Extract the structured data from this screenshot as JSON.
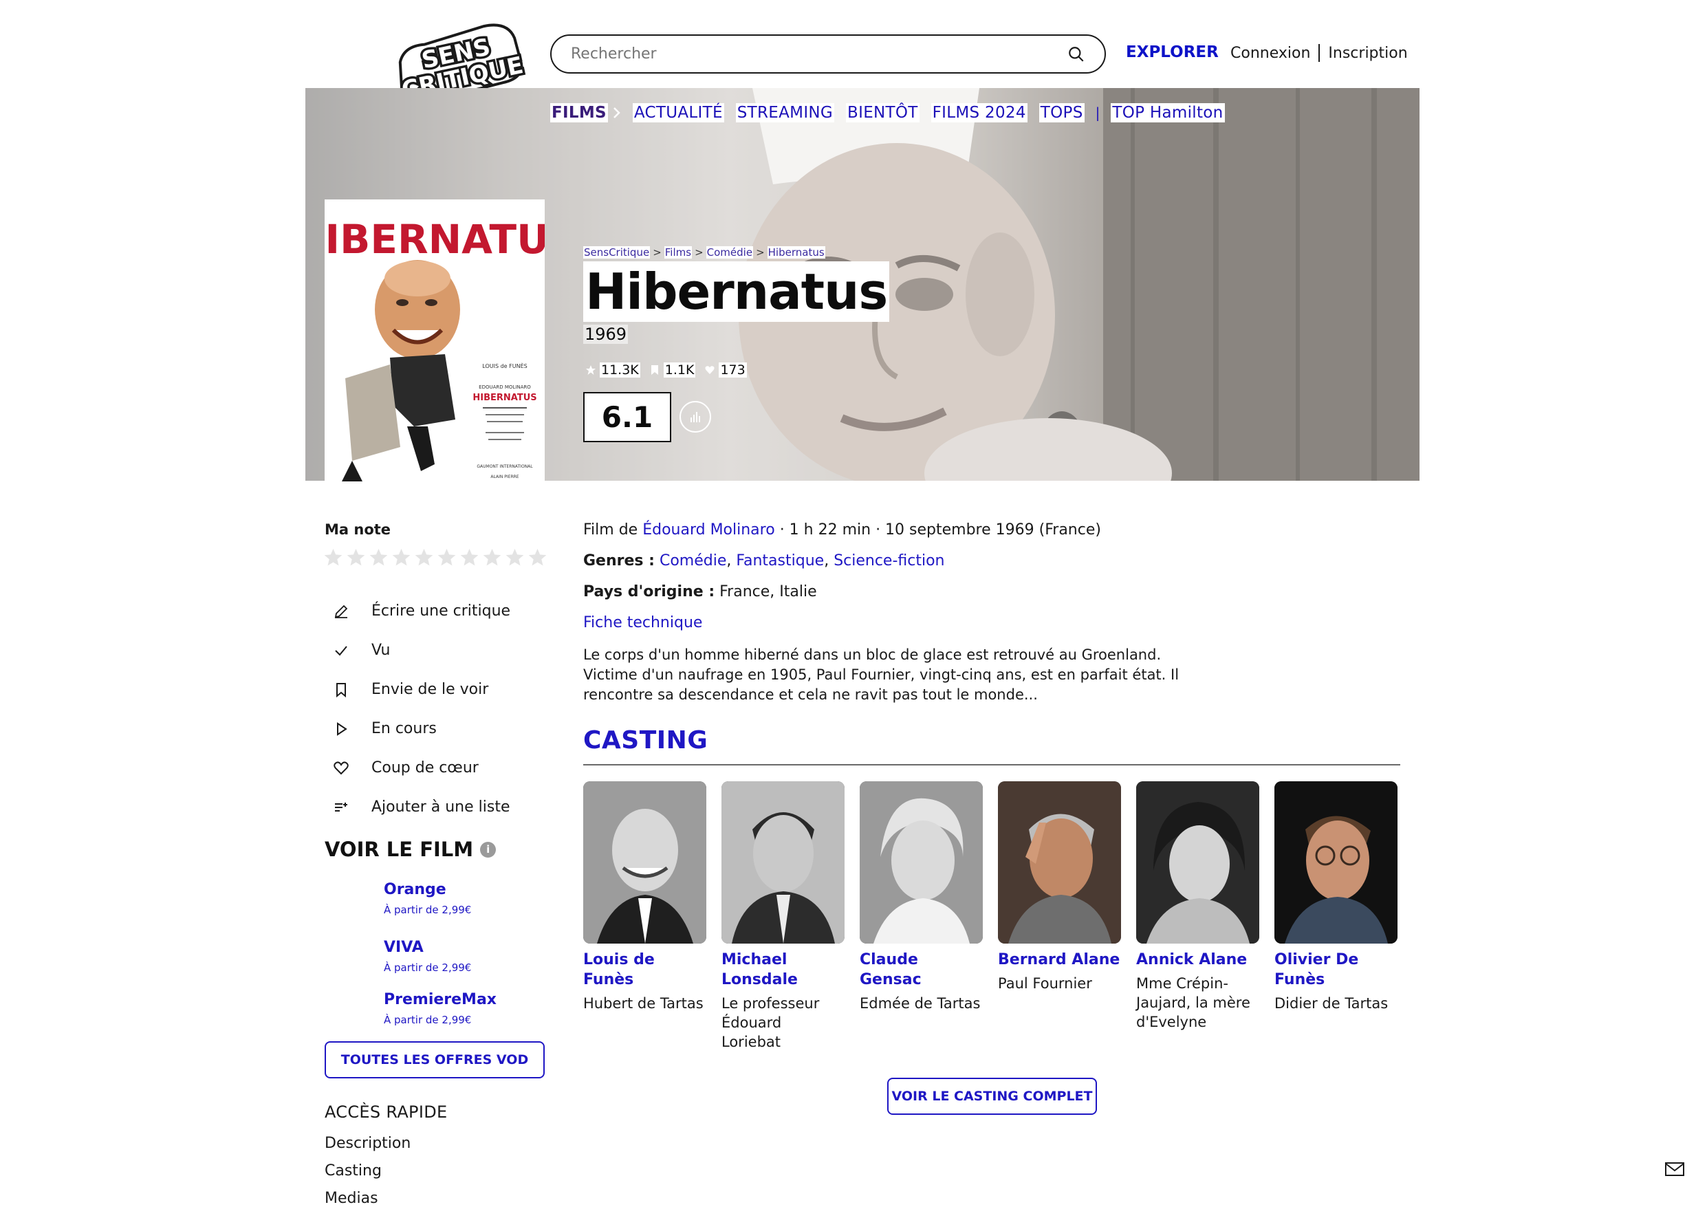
{
  "header": {
    "logo_text_line1": "SENS",
    "logo_text_line2": "CRITIQUE",
    "search_placeholder": "Rechercher",
    "explorer": "EXPLORER",
    "login": "Connexion",
    "signup": "Inscription"
  },
  "nav": {
    "films": "FILMS",
    "items": [
      "ACTUALITÉ",
      "STREAMING",
      "BIENTÔT",
      "FILMS 2024",
      "TOPS"
    ],
    "top_hamilton": "TOP Hamilton"
  },
  "breadcrumb": [
    "SensCritique",
    "Films",
    "Comédie",
    "Hibernatus"
  ],
  "movie": {
    "title": "Hibernatus",
    "year": "1969",
    "stats": {
      "ratings": "11.3K",
      "wishlist": "1.1K",
      "favorites": "173"
    },
    "score": "6.1",
    "poster": {
      "title": "HIBERNATUS",
      "actor": "LOUIS de FUNÈS",
      "director_line": "EDOUARD MOLINARO",
      "film_title_small": "HIBERNATUS",
      "studio": "GAUMONT INTERNATIONAL",
      "music": "ALAIN PIERRE"
    }
  },
  "left": {
    "ma_note": "Ma note",
    "star_count": 10,
    "actions": [
      {
        "label": "Écrire une critique",
        "icon": "pencil-icon"
      },
      {
        "label": "Vu",
        "icon": "check-icon"
      },
      {
        "label": "Envie de le voir",
        "icon": "bookmark-icon"
      },
      {
        "label": "En cours",
        "icon": "play-icon"
      },
      {
        "label": "Coup de cœur",
        "icon": "heart-icon"
      },
      {
        "label": "Ajouter à une liste",
        "icon": "list-add-icon"
      }
    ],
    "voir_title": "VOIR LE FILM",
    "offers": [
      {
        "name": "Orange",
        "price": "À partir de 2,99€"
      },
      {
        "name": "VIVA",
        "price": "À partir de 2,99€"
      },
      {
        "name": "PremiereMax",
        "price": "À partir de 2,99€"
      }
    ],
    "vod_button": "TOUTES LES OFFRES VOD",
    "acces_title": "ACCÈS RAPIDE",
    "quick_links": [
      "Description",
      "Casting",
      "Medias"
    ]
  },
  "details": {
    "film_de": "Film de",
    "director": "Édouard Molinaro",
    "meta": "· 1 h 22 min · 10 septembre 1969 (France)",
    "genres_label": "Genres :",
    "genres": [
      "Comédie",
      "Fantastique",
      "Science-fiction"
    ],
    "pays_label": "Pays d'origine :",
    "pays": "France, Italie",
    "fiche": "Fiche technique",
    "synopsis": "Le corps d'un homme hiberné dans un bloc de glace est retrouvé au Groenland. Victime d'un naufrage en 1905, Paul Fournier, vingt-cinq ans, est en parfait état. Il rencontre sa descendance et cela ne ravit pas tout le monde..."
  },
  "casting": {
    "title": "CASTING",
    "actors": [
      {
        "name": "Louis de Funès",
        "role": "Hubert de Tartas"
      },
      {
        "name": "Michael Lonsdale",
        "role": "Le professeur Édouard Loriebat"
      },
      {
        "name": "Claude Gensac",
        "role": "Edmée de Tartas"
      },
      {
        "name": "Bernard Alane",
        "role": "Paul Fournier"
      },
      {
        "name": "Annick Alane",
        "role": "Mme Crépin-Jaujard, la mère d'Evelyne"
      },
      {
        "name": "Olivier De Funès",
        "role": "Didier de Tartas"
      }
    ],
    "button": "VOIR LE CASTING COMPLET"
  },
  "colors": {
    "accent": "#1f17c4",
    "nav": "#1c11b8",
    "text": "#1a1a1a"
  }
}
